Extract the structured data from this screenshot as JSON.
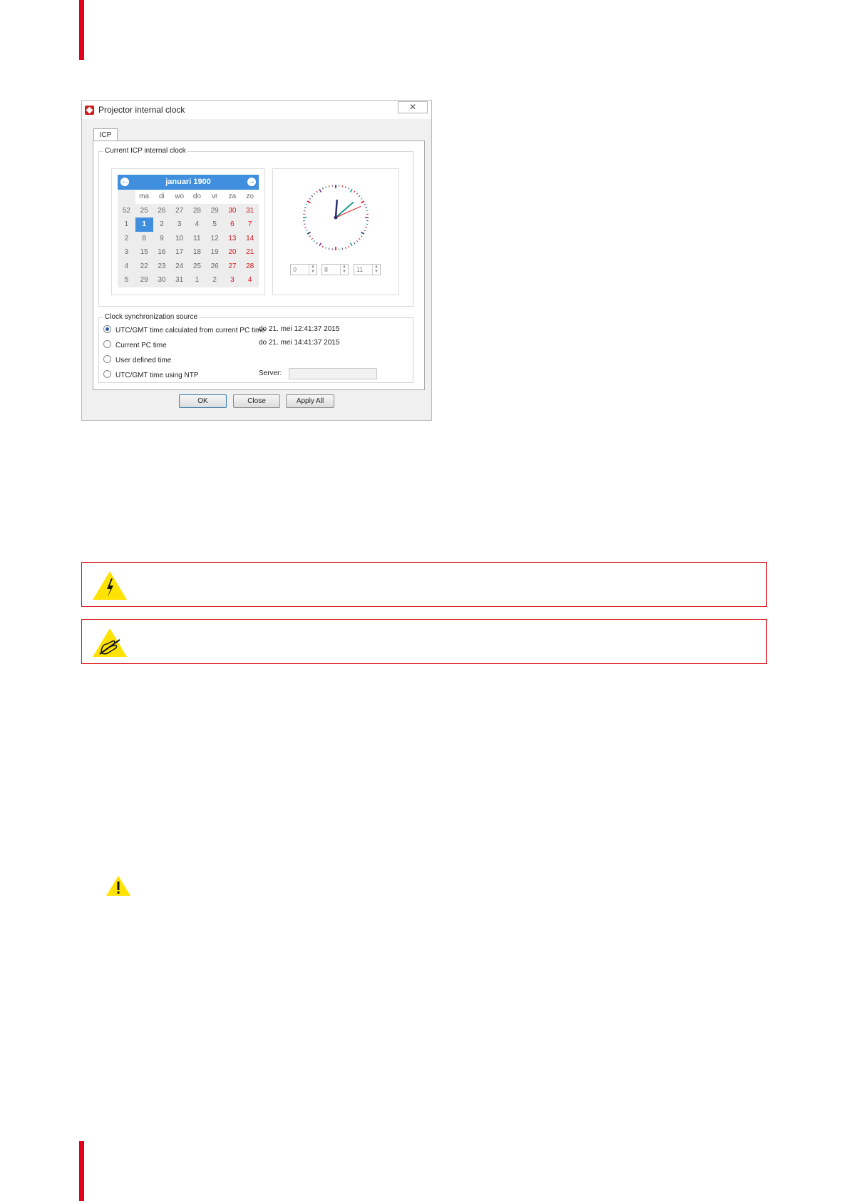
{
  "dialog": {
    "title": "Projector internal clock",
    "close_icon": "close-icon",
    "tab": "ICP",
    "group_title": "Current ICP internal clock",
    "calendar": {
      "month_year": "januari 1900",
      "weekdays": [
        "ma",
        "di",
        "wo",
        "do",
        "vr",
        "za",
        "zo"
      ],
      "weeks": [
        {
          "week": "52",
          "days": [
            "25",
            "26",
            "27",
            "28",
            "29",
            "30",
            "31"
          ]
        },
        {
          "week": "1",
          "days": [
            "1",
            "2",
            "3",
            "4",
            "5",
            "6",
            "7"
          ]
        },
        {
          "week": "2",
          "days": [
            "8",
            "9",
            "10",
            "11",
            "12",
            "13",
            "14"
          ]
        },
        {
          "week": "3",
          "days": [
            "15",
            "16",
            "17",
            "18",
            "19",
            "20",
            "21"
          ]
        },
        {
          "week": "4",
          "days": [
            "22",
            "23",
            "24",
            "25",
            "26",
            "27",
            "28"
          ]
        },
        {
          "week": "5",
          "days": [
            "29",
            "30",
            "31",
            "1",
            "2",
            "3",
            "4"
          ]
        }
      ],
      "selected_day": "1",
      "weekend_color": "#d8141a",
      "accent_color": "#3f8fde"
    },
    "time": {
      "hours": "0",
      "minutes": "8",
      "seconds": "11"
    },
    "sync": {
      "title": "Clock synchronization source",
      "options": [
        {
          "label": "UTC/GMT time calculated from current PC time",
          "value": "do 21. mei 12:41:37 2015",
          "selected": true
        },
        {
          "label": "Current PC time",
          "value": "do 21. mei 14:41:37 2015",
          "selected": false
        },
        {
          "label": "User defined time",
          "value": "",
          "selected": false
        },
        {
          "label": "UTC/GMT time using NTP",
          "value": "",
          "selected": false
        }
      ],
      "server_label": "Server:",
      "server_value": ""
    },
    "buttons": {
      "ok": "OK",
      "close": "Close",
      "apply_all": "Apply All"
    }
  },
  "warnings": [
    {
      "icon": "electrical-hazard-icon"
    },
    {
      "icon": "esd-hazard-icon"
    }
  ],
  "caution_icon": "caution-exclamation-icon",
  "brand_color": "#e0001b"
}
